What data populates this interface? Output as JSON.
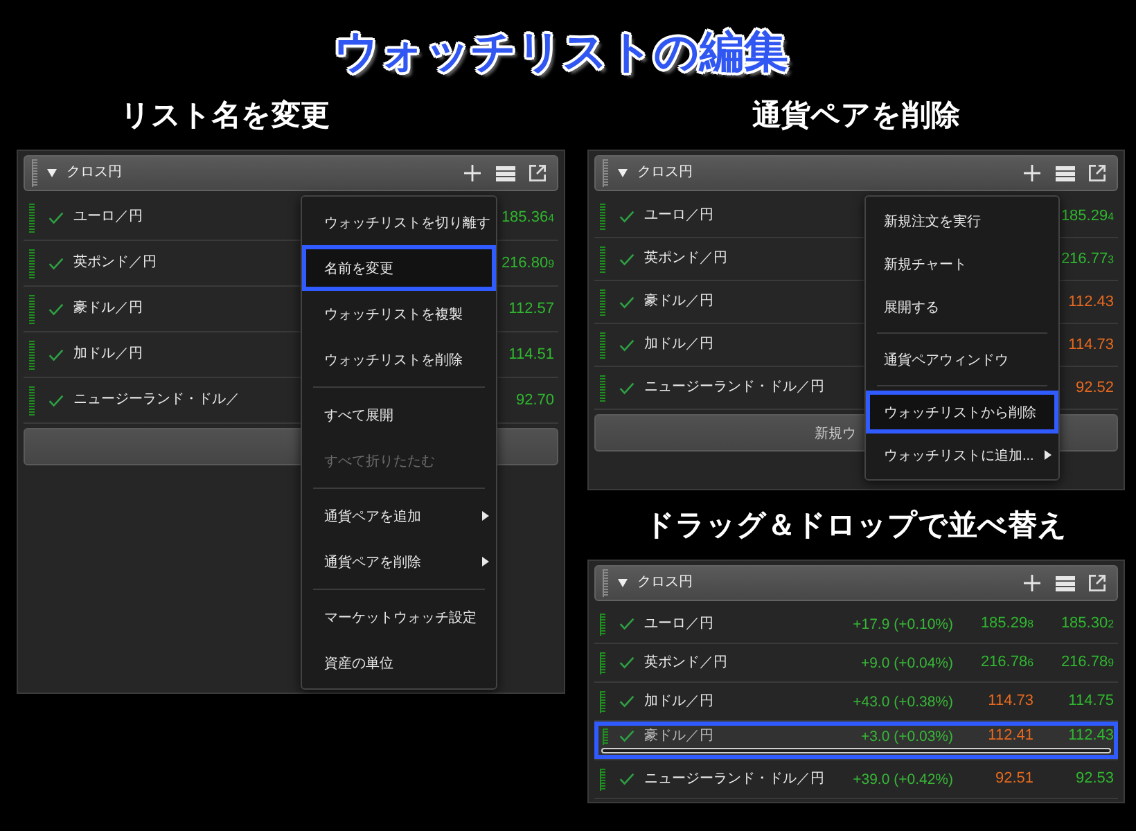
{
  "title": "ウォッチリストの編集",
  "sections": [
    {
      "heading": "リスト名を変更",
      "watchlist": {
        "name": "クロス円",
        "rows": [
          {
            "pair": "ユーロ／円",
            "checked": true,
            "prices": [
              {
                "text": "185.36$_{4}$",
                "color": "#2fb82f"
              }
            ]
          },
          {
            "pair": "英ポンド／円",
            "checked": true,
            "prices": [
              {
                "text": "216.80$_{9}$",
                "color": "#2fb82f"
              }
            ]
          },
          {
            "pair": "豪ドル／円",
            "checked": true,
            "prices": [
              {
                "text": "112.57",
                "color": "#2fb82f"
              }
            ]
          },
          {
            "pair": "加ドル／円",
            "checked": true,
            "prices": [
              {
                "text": "114.51",
                "color": "#2fb82f"
              }
            ]
          },
          {
            "pair": "ニュージーランド・ドル／",
            "checked": true,
            "prices": [
              {
                "text": "92.70",
                "color": "#2fb82f"
              }
            ]
          }
        ],
        "footer_button": {
          "shown": true
        }
      },
      "menu": {
        "groups": [
          [
            {
              "label": "ウォッチリストを切り離す",
              "highlighted": false,
              "disabled": false,
              "submenu": false
            },
            {
              "label": "名前を変更",
              "highlighted": true,
              "disabled": false,
              "submenu": false
            },
            {
              "label": "ウォッチリストを複製",
              "highlighted": false,
              "disabled": false,
              "submenu": false
            },
            {
              "label": "ウォッチリストを削除",
              "highlighted": false,
              "disabled": false,
              "submenu": false
            }
          ],
          [
            {
              "label": "すべて展開",
              "highlighted": false,
              "disabled": false,
              "submenu": false
            },
            {
              "label": "すべて折りたたむ",
              "highlighted": false,
              "disabled": true,
              "submenu": false
            }
          ],
          [
            {
              "label": "通貨ペアを追加",
              "highlighted": false,
              "disabled": false,
              "submenu": true
            },
            {
              "label": "通貨ペアを削除",
              "highlighted": false,
              "disabled": false,
              "submenu": true
            }
          ],
          [
            {
              "label": "マーケットウォッチ設定",
              "highlighted": false,
              "disabled": false,
              "submenu": false
            },
            {
              "label": "資産の単位",
              "highlighted": false,
              "disabled": false,
              "submenu": false
            }
          ]
        ]
      }
    },
    {
      "heading": "通貨ペアを削除",
      "watchlist": {
        "name": "クロス円",
        "rows": [
          {
            "pair": "ユーロ／円",
            "checked": true,
            "prices": [
              {
                "text": "185.29$_{4}$",
                "color": "#2fb82f"
              }
            ]
          },
          {
            "pair": "英ポンド／円",
            "checked": true,
            "prices": [
              {
                "text": "216.77$_{3}$",
                "color": "#2fb82f"
              }
            ]
          },
          {
            "pair": "豪ドル／円",
            "checked": true,
            "prices": [
              {
                "text": "112.43",
                "color": "#e8691e"
              }
            ]
          },
          {
            "pair": "加ドル／円",
            "checked": true,
            "prices": [
              {
                "text": "114.73",
                "color": "#e8691e"
              }
            ]
          },
          {
            "pair": "ニュージーランド・ドル／円",
            "checked": true,
            "prices": [
              {
                "text": "92.52",
                "color": "#e8691e"
              }
            ]
          }
        ],
        "footer_button": {
          "shown": true,
          "label": "新規ウ"
        }
      },
      "menu": {
        "groups": [
          [
            {
              "label": "新規注文を実行",
              "highlighted": false,
              "disabled": false,
              "submenu": false
            },
            {
              "label": "新規チャート",
              "highlighted": false,
              "disabled": false,
              "submenu": false
            },
            {
              "label": "展開する",
              "highlighted": false,
              "disabled": false,
              "submenu": false
            }
          ],
          [
            {
              "label": "通貨ペアウィンドウ",
              "highlighted": false,
              "disabled": false,
              "submenu": false
            }
          ],
          [
            {
              "label": "ウォッチリストから削除",
              "highlighted": true,
              "disabled": false,
              "submenu": false
            },
            {
              "label": "ウォッチリストに追加...",
              "highlighted": false,
              "disabled": false,
              "submenu": true
            }
          ]
        ]
      }
    },
    {
      "heading": "ドラッグ＆ドロップで並べ替え",
      "watchlist": {
        "name": "クロス円",
        "rows": [
          {
            "pair": "ユーロ／円",
            "checked": true,
            "highlighted": false,
            "change": "+17.9 (+0.10%)",
            "prices": [
              {
                "text": "185.29$_{8}$",
                "color": "#2fb82f"
              },
              {
                "text": "185.30$_{2}$",
                "color": "#2fb82f"
              }
            ]
          },
          {
            "pair": "英ポンド／円",
            "checked": true,
            "highlighted": false,
            "change": "+9.0 (+0.04%)",
            "prices": [
              {
                "text": "216.78$_{6}$",
                "color": "#2fb82f"
              },
              {
                "text": "216.78$_{9}$",
                "color": "#2fb82f"
              }
            ]
          },
          {
            "pair": "加ドル／円",
            "checked": true,
            "highlighted": false,
            "change": "+43.0 (+0.38%)",
            "prices": [
              {
                "text": "114.73",
                "color": "#e8691e"
              },
              {
                "text": "114.75",
                "color": "#2fb82f"
              }
            ]
          },
          {
            "pair": "豪ドル／円",
            "checked": true,
            "highlighted": true,
            "change": "+3.0 (+0.03%)",
            "prices": [
              {
                "text": "112.41",
                "color": "#e8691e"
              },
              {
                "text": "112.43",
                "color": "#2fb82f"
              }
            ]
          },
          {
            "pair": "ニュージーランド・ドル／円",
            "checked": true,
            "highlighted": false,
            "change": "+39.0 (+0.42%)",
            "prices": [
              {
                "text": "92.51",
                "color": "#e8691e"
              },
              {
                "text": "92.53",
                "color": "#2fb82f"
              }
            ]
          }
        ]
      }
    }
  ]
}
